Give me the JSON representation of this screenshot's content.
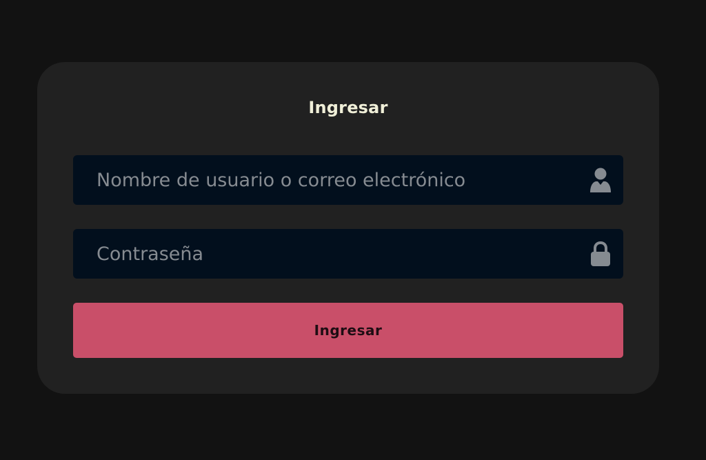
{
  "login": {
    "title": "Ingresar",
    "username": {
      "value": "",
      "placeholder": "Nombre de usuario o correo electrónico",
      "icon": "user-icon"
    },
    "password": {
      "value": "",
      "placeholder": "Contraseña",
      "icon": "lock-icon"
    },
    "submit_label": "Ingresar"
  },
  "colors": {
    "page_background": "#121212",
    "card_background": "#212121",
    "field_background": "#020f1d",
    "title_text": "#f0efd8",
    "placeholder_text": "#868b91",
    "icon": "#868b91",
    "button_background": "#c94f69",
    "button_text": "#1e0d13"
  }
}
